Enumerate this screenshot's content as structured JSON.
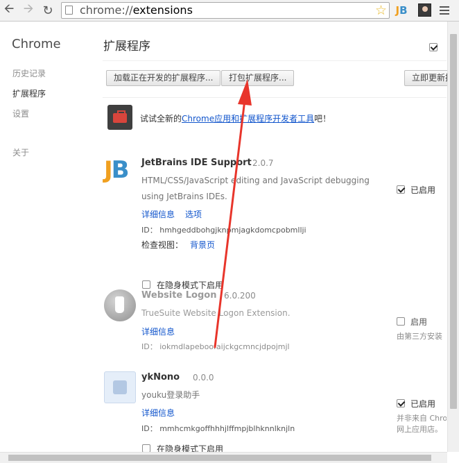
{
  "toolbar": {
    "url_scheme": "chrome://",
    "url_host": "extensions",
    "back_icon": "arrow-left-icon",
    "forward_icon": "arrow-right-icon",
    "reload_icon": "reload-icon",
    "star_icon": "star-icon",
    "jb_badge": "J",
    "jb_badge_b": "B"
  },
  "sidebar": {
    "brand": "Chrome",
    "items": [
      {
        "label": "历史记录"
      },
      {
        "label": "扩展程序"
      },
      {
        "label": "设置"
      },
      {
        "label": "关于"
      }
    ]
  },
  "main": {
    "title": "扩展程序",
    "developer_mode_checked": true,
    "buttons": {
      "load_unpacked": "加载正在开发的扩展程序...",
      "pack": "打包扩展程序...",
      "update": "立即更新扩"
    },
    "promo": {
      "prefix": "试试全新的",
      "link": "Chrome应用和扩展程序开发者工具",
      "suffix": "吧！"
    }
  },
  "extensions": [
    {
      "name": "JetBrains IDE Support",
      "version": "2.0.7",
      "description": "HTML/CSS/JavaScript editing and JavaScript debugging using JetBrains IDEs.",
      "details_link": "详细信息",
      "options_link": "选项",
      "id_label": "ID：",
      "id": "hmhgeddbohgjknpmjagkdomcpobmllji",
      "inspect_label": "检查视图：",
      "inspect_link": "背景页",
      "incognito_label": "在隐身模式下启用",
      "enabled": true,
      "enable_label": "已启用"
    },
    {
      "name": "Website Logon",
      "version": "6.0.200",
      "description": "TrueSuite Website Logon Extension.",
      "details_link": "详细信息",
      "id_label": "ID：",
      "id": "iokmdlapeboofaijckgcmncjdpojmjl",
      "enabled": false,
      "enable_label": "启用",
      "note": "由第三方安装"
    },
    {
      "name": "ykNono",
      "version": "0.0.0",
      "description": "youku登录助手",
      "details_link": "详细信息",
      "id_label": "ID：",
      "id": "mmhcmkgoffhhhjlffmpjblhknnlknjln",
      "incognito_label": "在隐身模式下启用",
      "enabled": true,
      "enable_label": "已启用",
      "note_line1": "并非来自 Chro",
      "note_line2": "网上应用店。"
    }
  ],
  "colors": {
    "link": "#1155cc",
    "annotation_arrow": "#e8352b",
    "jb_orange": "#f0a020",
    "jb_blue": "#3a8fc9"
  }
}
